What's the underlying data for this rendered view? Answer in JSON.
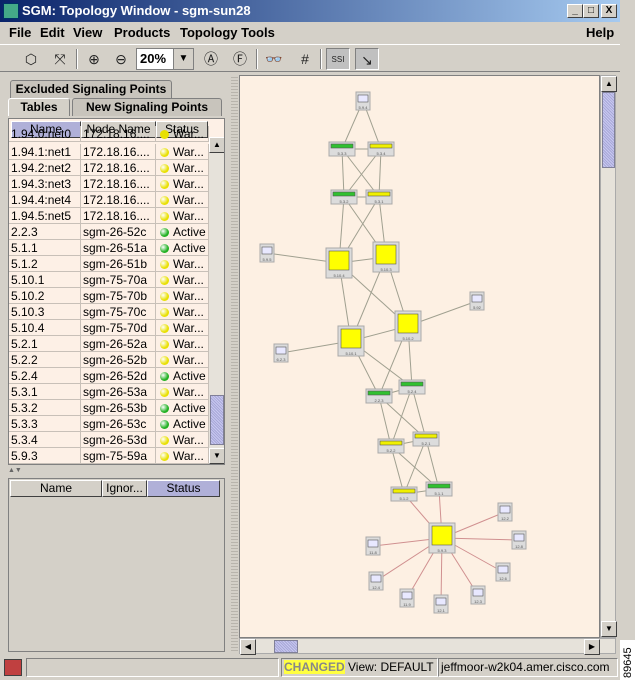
{
  "window": {
    "title": "SGM: Topology Window - sgm-sun28",
    "controls": [
      "_",
      "□",
      "X"
    ]
  },
  "menu": [
    "File",
    "Edit",
    "View",
    "Products",
    "Topology Tools",
    "Help"
  ],
  "toolbar": {
    "zoom_value": "20%",
    "buttons": [
      "circle-layout",
      "spring-layout",
      "zoom-in",
      "zoom-out",
      "zoom-all",
      "zoom-fit",
      "find",
      "grid",
      "ssi-label",
      "link-tool"
    ]
  },
  "tabs": {
    "row1": [
      "Excluded Signaling Points"
    ],
    "row2": [
      "Tables",
      "New Signaling Points"
    ]
  },
  "table": {
    "headers": [
      "Name",
      "Node Name",
      "Status"
    ],
    "partial_row": {
      "name": "1.94.0:net0",
      "node": "172.18.16....",
      "status": "War..."
    },
    "rows": [
      {
        "name": "1.94.1:net1",
        "node": "172.18.16....",
        "status": "War...",
        "color": "#e8e000"
      },
      {
        "name": "1.94.2:net2",
        "node": "172.18.16....",
        "status": "War...",
        "color": "#e8e000"
      },
      {
        "name": "1.94.3:net3",
        "node": "172.18.16....",
        "status": "War...",
        "color": "#e8e000"
      },
      {
        "name": "1.94.4:net4",
        "node": "172.18.16....",
        "status": "War...",
        "color": "#e8e000"
      },
      {
        "name": "1.94.5:net5",
        "node": "172.18.16....",
        "status": "War...",
        "color": "#e8e000"
      },
      {
        "name": "2.2.3",
        "node": "sgm-26-52c",
        "status": "Active",
        "color": "#20b020"
      },
      {
        "name": "5.1.1",
        "node": "sgm-26-51a",
        "status": "Active",
        "color": "#20b020"
      },
      {
        "name": "5.1.2",
        "node": "sgm-26-51b",
        "status": "War...",
        "color": "#e8e000"
      },
      {
        "name": "5.10.1",
        "node": "sgm-75-70a",
        "status": "War...",
        "color": "#e8e000"
      },
      {
        "name": "5.10.2",
        "node": "sgm-75-70b",
        "status": "War...",
        "color": "#e8e000"
      },
      {
        "name": "5.10.3",
        "node": "sgm-75-70c",
        "status": "War...",
        "color": "#e8e000"
      },
      {
        "name": "5.10.4",
        "node": "sgm-75-70d",
        "status": "War...",
        "color": "#e8e000"
      },
      {
        "name": "5.2.1",
        "node": "sgm-26-52a",
        "status": "War...",
        "color": "#e8e000"
      },
      {
        "name": "5.2.2",
        "node": "sgm-26-52b",
        "status": "War...",
        "color": "#e8e000"
      },
      {
        "name": "5.2.4",
        "node": "sgm-26-52d",
        "status": "Active",
        "color": "#20b020"
      },
      {
        "name": "5.3.1",
        "node": "sgm-26-53a",
        "status": "War...",
        "color": "#e8e000"
      },
      {
        "name": "5.3.2",
        "node": "sgm-26-53b",
        "status": "Active",
        "color": "#20b020"
      },
      {
        "name": "5.3.3",
        "node": "sgm-26-53c",
        "status": "Active",
        "color": "#20b020"
      },
      {
        "name": "5.3.4",
        "node": "sgm-26-53d",
        "status": "War...",
        "color": "#e8e000"
      },
      {
        "name": "5.9.3",
        "node": "sgm-75-59a",
        "status": "War...",
        "color": "#e8e000"
      }
    ]
  },
  "lower_table": {
    "headers": [
      "Name",
      "Ignor...",
      "Status"
    ]
  },
  "graph": {
    "nodes": [
      {
        "label": "5.9.4",
        "type": "pc"
      },
      {
        "label": "5.3.3",
        "type": "green"
      },
      {
        "label": "5.3.4",
        "type": "yellow"
      },
      {
        "label": "5.3.2",
        "type": "green"
      },
      {
        "label": "5.3.1",
        "type": "yellow"
      },
      {
        "label": "5.9.5",
        "type": "pc"
      },
      {
        "label": "5.10.4",
        "type": "big"
      },
      {
        "label": "5.10.3",
        "type": "big"
      },
      {
        "label": "5.92",
        "type": "pc"
      },
      {
        "label": "5.10.2",
        "type": "big"
      },
      {
        "label": "5.10.1",
        "type": "big"
      },
      {
        "label": "6.2.3",
        "type": "pc"
      },
      {
        "label": "2.2.3",
        "type": "green"
      },
      {
        "label": "5.2.4",
        "type": "green"
      },
      {
        "label": "5.2.2",
        "type": "yellow"
      },
      {
        "label": "5.2.1",
        "type": "yellow"
      },
      {
        "label": "5.1.2",
        "type": "yellow"
      },
      {
        "label": "5.1.1",
        "type": "green"
      },
      {
        "label": "5.9.3",
        "type": "big"
      },
      {
        "label": "12.2",
        "type": "pc"
      },
      {
        "label": "12.8",
        "type": "pc"
      },
      {
        "label": "12.6",
        "type": "pc"
      },
      {
        "label": "12.3",
        "type": "pc"
      },
      {
        "label": "12.1",
        "type": "pc"
      },
      {
        "label": "11.9",
        "type": "pc"
      },
      {
        "label": "12.4",
        "type": "pc"
      },
      {
        "label": "11.8",
        "type": "pc"
      }
    ]
  },
  "status": {
    "changed": "CHANGED",
    "view": "View: DEFAULT",
    "host": "jeffmoor-w2k04.amer.cisco.com"
  },
  "figure_id": "89645"
}
